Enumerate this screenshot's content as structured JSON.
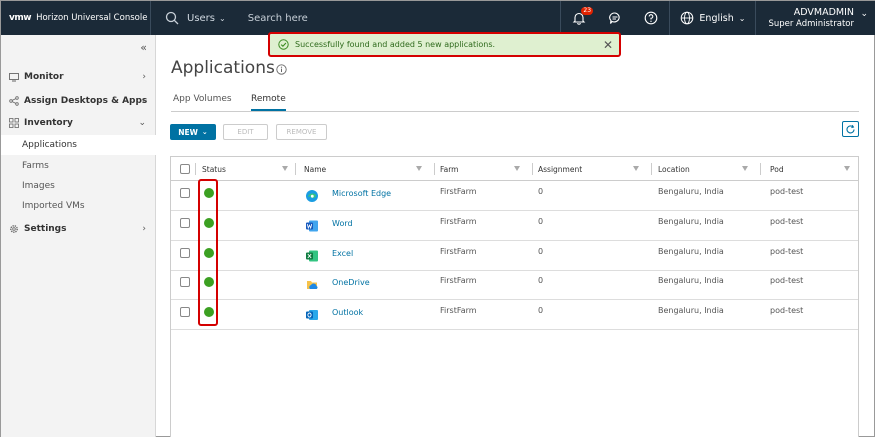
{
  "header": {
    "logo": "vmw",
    "title": "Horizon Universal Console",
    "search_scope": "Users",
    "search_placeholder": "Search here",
    "notification_count": "23",
    "language": "English",
    "user_name": "ADVMADMIN",
    "user_role": "Super Administrator"
  },
  "sidebar": {
    "groups": {
      "monitor": "Monitor",
      "assign": "Assign Desktops & Apps",
      "inventory": "Inventory",
      "settings": "Settings"
    },
    "inventory_items": [
      "Applications",
      "Farms",
      "Images",
      "Imported VMs"
    ]
  },
  "toast": {
    "message": "Successfully found and added 5 new applications."
  },
  "page": {
    "title": "Applications",
    "tabs": [
      "App Volumes",
      "Remote"
    ],
    "active_tab": "Remote"
  },
  "toolbar": {
    "new_label": "NEW",
    "edit_label": "EDIT",
    "remove_label": "REMOVE"
  },
  "table": {
    "columns": [
      "Status",
      "Name",
      "Farm",
      "Assignment",
      "Location",
      "Pod"
    ],
    "rows": [
      {
        "status": "green",
        "name": "Microsoft Edge",
        "icon": "edge-icon",
        "farm": "FirstFarm",
        "assignment": "0",
        "location": "Bengaluru, India",
        "pod": "pod-test"
      },
      {
        "status": "green",
        "name": "Word",
        "icon": "word-icon",
        "farm": "FirstFarm",
        "assignment": "0",
        "location": "Bengaluru, India",
        "pod": "pod-test"
      },
      {
        "status": "green",
        "name": "Excel",
        "icon": "excel-icon",
        "farm": "FirstFarm",
        "assignment": "0",
        "location": "Bengaluru, India",
        "pod": "pod-test"
      },
      {
        "status": "green",
        "name": "OneDrive",
        "icon": "onedrive-icon",
        "farm": "FirstFarm",
        "assignment": "0",
        "location": "Bengaluru, India",
        "pod": "pod-test"
      },
      {
        "status": "green",
        "name": "Outlook",
        "icon": "outlook-icon",
        "farm": "FirstFarm",
        "assignment": "0",
        "location": "Bengaluru, India",
        "pod": "pod-test"
      }
    ]
  },
  "colors": {
    "header_bg": "#1b2a38",
    "accent": "#0072a3",
    "status_ok": "#3ca022",
    "highlight": "#d40000"
  }
}
